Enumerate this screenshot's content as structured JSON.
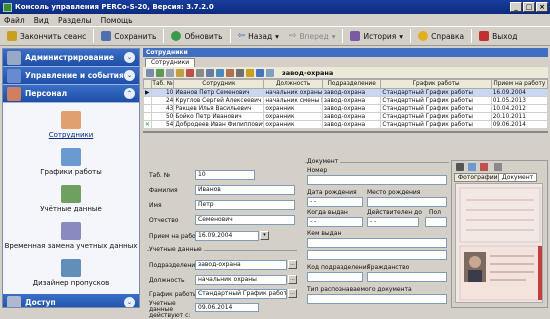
{
  "window": {
    "title": "Консоль управления PERCo-S-20, Версия: 3.7.2.0"
  },
  "menu": [
    "Файл",
    "Вид",
    "Разделы",
    "Помощь"
  ],
  "toolbar": {
    "end_session": "Закончить сеанс",
    "save": "Сохранить",
    "refresh": "Обновить",
    "back": "Назад",
    "forward": "Вперед",
    "history": "История",
    "help": "Справка",
    "exit": "Выход"
  },
  "sidebar": {
    "admin": "Администрирование",
    "control": "Управление и события",
    "personnel": "Персонал",
    "access": "Доступ",
    "items": [
      "Сотрудники",
      "Графики работы",
      "Учётные данные",
      "Временная замена учетных данных",
      "Дизайнер пропусков"
    ]
  },
  "grid": {
    "header": "Сотрудники",
    "tab": "Сотрудники",
    "department": "завод-охрана",
    "columns": [
      "",
      "Таб. №",
      "Сотрудник",
      "Должность",
      "Подразделение",
      "График работы",
      "Прием на работу"
    ],
    "rows": [
      [
        "▶",
        "10",
        "Иванов Петр Семенович",
        "начальник охраны",
        "завод-охрана",
        "Стандартный График работы",
        "16.09.2004"
      ],
      [
        "",
        "24",
        "Круглов Сергей Алексеевич",
        "начальник смены ПЦН",
        "завод-охрана",
        "Стандартный График работы",
        "01.05.2013"
      ],
      [
        "",
        "43",
        "Ракцев Илья Васильевич",
        "охранник",
        "завод-охрана",
        "Стандартный График работы",
        "10.04.2012"
      ],
      [
        "",
        "50",
        "Бойко Петр Иванович",
        "охранник",
        "завод-охрана",
        "Стандартный График работы",
        "20.10.2011"
      ],
      [
        "✕",
        "54",
        "Добродеев Иван Филиппович",
        "охранник",
        "завод-охрана",
        "Стандартный График работы",
        "09.06.2014"
      ],
      [
        "",
        "",
        "",
        "",
        "",
        "",
        ""
      ]
    ]
  },
  "form": {
    "tab_label": "Таб. №",
    "tab_value": "10",
    "lastname_label": "Фамилия",
    "lastname_value": "Иванов",
    "firstname_label": "Имя",
    "firstname_value": "Петр",
    "patronymic_label": "Отчество",
    "patronymic_value": "Семенович",
    "hire_label": "Прием на работу",
    "hire_value": "16.09.2004",
    "cred_group": "Учетные данные",
    "dept_label": "Подразделение",
    "dept_value": "завод-охрана",
    "position_label": "Должность",
    "position_value": "начальник охраны",
    "schedule_label": "График работы",
    "schedule_value": "Стандартный График работы",
    "valid_label": "Учетные данные действуют с:",
    "valid_value": "09.06.2014"
  },
  "document": {
    "group": "Документ",
    "number": "Номер",
    "birth_date": "Дата рождения",
    "birth_place": "Место рождения",
    "issued_when": "Когда выдан",
    "valid_until": "Действителен до",
    "gender": "Пол",
    "issued_by": "Кем выдан",
    "subdivision_code": "Код подразделения",
    "citizenship": "Гражданство",
    "doc_type": "Тип распознаваемого документа",
    "date_placeholder": "-  -"
  },
  "photo": {
    "tab_photos": "Фотографии",
    "tab_document": "Документ"
  },
  "colors": {
    "title": "#0a2a80",
    "sidebar_header": "#1f4ea5",
    "grid_header": "#3f6fc0",
    "selection": "#c9d8f0"
  }
}
